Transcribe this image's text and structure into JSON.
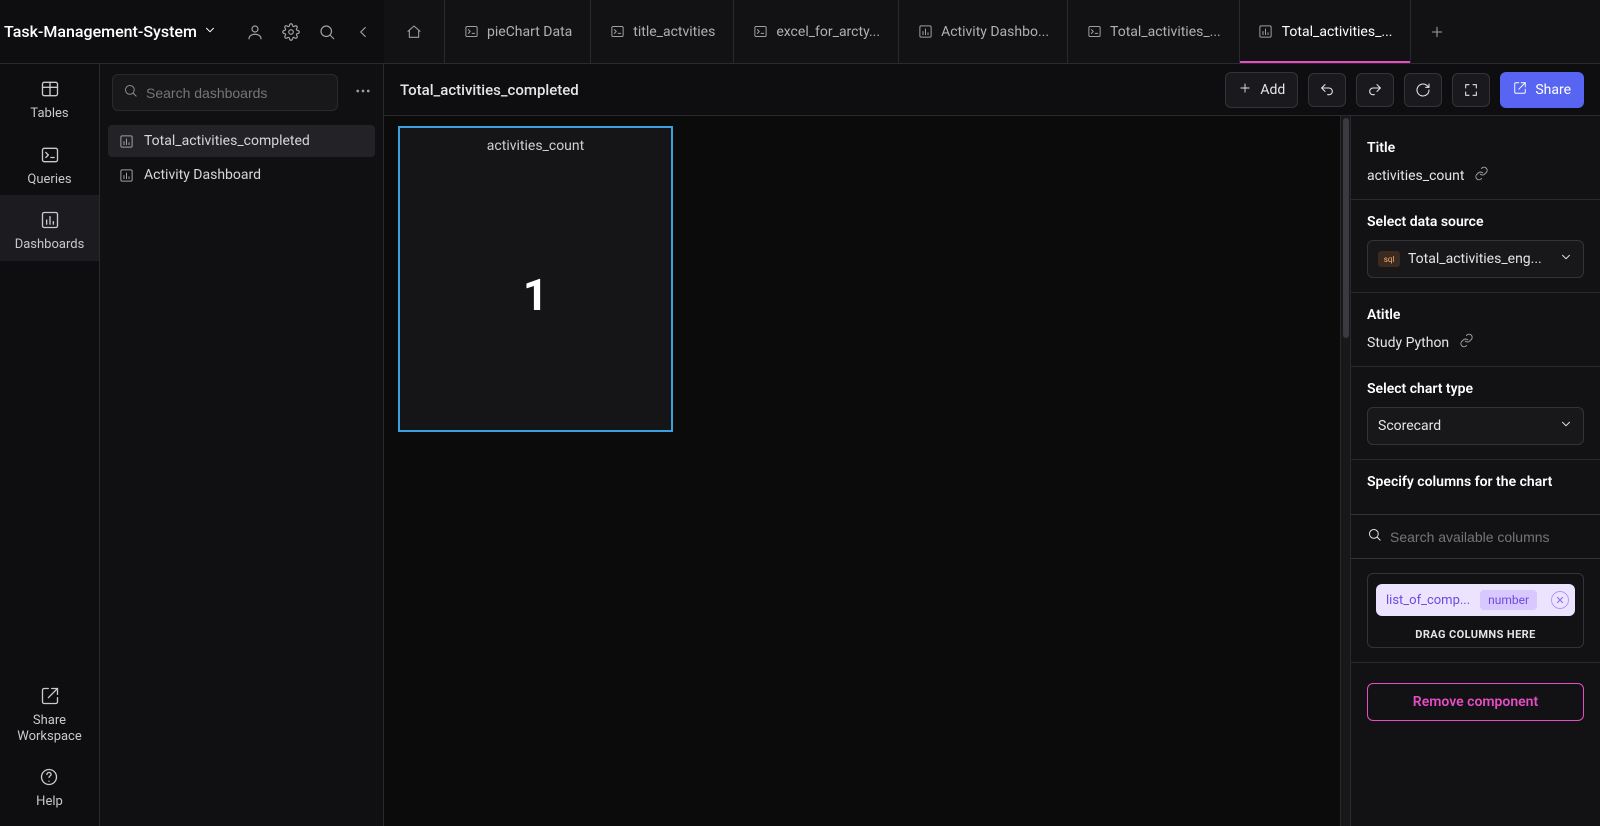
{
  "workspace": {
    "name": "Task-Management-System"
  },
  "rail": {
    "tables": "Tables",
    "queries": "Queries",
    "dashboards": "Dashboards",
    "share": "Share Workspace",
    "help": "Help"
  },
  "sidebar": {
    "search_placeholder": "Search dashboards",
    "items": [
      {
        "label": "Total_activities_completed",
        "active": true
      },
      {
        "label": "Activity Dashboard",
        "active": false
      }
    ]
  },
  "tabs": [
    {
      "label": "pieChart Data",
      "icon": "query",
      "active": false
    },
    {
      "label": "title_actvities",
      "icon": "query",
      "active": false
    },
    {
      "label": "excel_for_arcty...",
      "icon": "query",
      "active": false
    },
    {
      "label": "Activity Dashbo...",
      "icon": "dashboard",
      "active": false
    },
    {
      "label": "Total_activities_...",
      "icon": "query",
      "active": false
    },
    {
      "label": "Total_activities_...",
      "icon": "dashboard",
      "active": true
    }
  ],
  "toolbar": {
    "title": "Total_activities_completed",
    "add": "Add",
    "share": "Share"
  },
  "card": {
    "title": "activities_count",
    "value": "1"
  },
  "panel": {
    "title_label": "Title",
    "title_value": "activities_count",
    "select_source_label": "Select data source",
    "select_source_value": "Total_activities_eng...",
    "atitle_label": "Atitle",
    "atitle_value": "Study Python",
    "chart_type_label": "Select chart type",
    "chart_type_value": "Scorecard",
    "columns_label": "Specify columns for the chart",
    "columns_search_placeholder": "Search available columns",
    "chip": {
      "name": "list_of_comp...",
      "type": "number"
    },
    "drag_hint": "DRAG COLUMNS HERE",
    "remove": "Remove component"
  }
}
